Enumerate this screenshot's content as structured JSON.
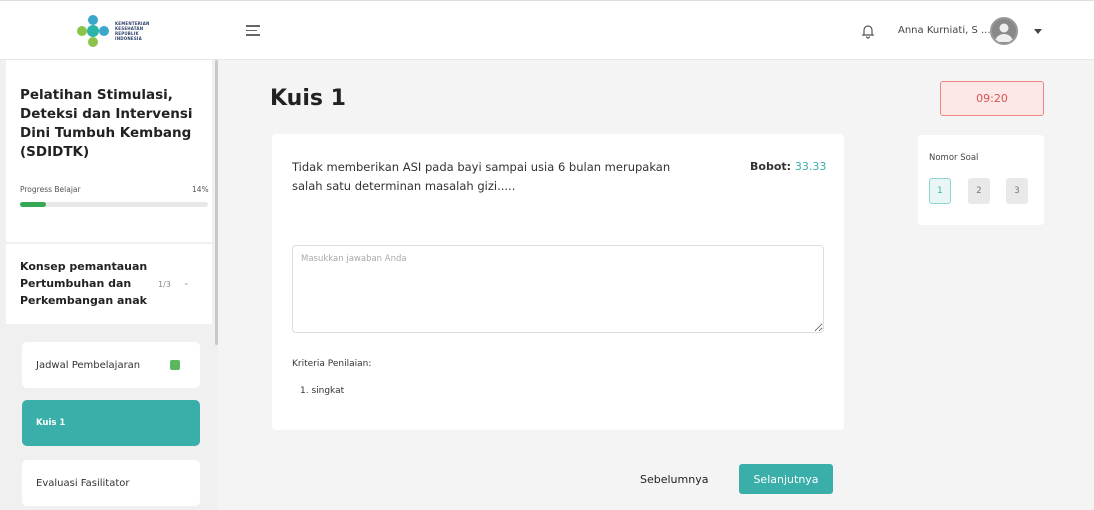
{
  "header": {
    "logo_text": [
      "KEMENTERIAN",
      "KESEHATAN",
      "REPUBLIK",
      "INDONESIA"
    ],
    "username": "Anna Kurniati, S ...",
    "icons": {
      "menu": "hamburger-icon",
      "notifications": "bell-icon",
      "dropdown": "caret-down-icon"
    }
  },
  "sidebar": {
    "course_title": "Pelatihan Stimulasi, Deteksi dan Intervensi Dini Tumbuh Kembang (SDIDTK)",
    "progress_label": "Progress Belajar",
    "progress_text": "14%",
    "progress_value": 0.14,
    "module_title": "Konsep pemantauan Pertumbuhan dan Perkembangan anak",
    "module_count": "1/3",
    "items": [
      {
        "label": "Jadwal Pembelajaran",
        "completed": true,
        "active": false
      },
      {
        "label": "Kuis 1",
        "completed": false,
        "active": true
      },
      {
        "label": "Evaluasi Fasilitator",
        "completed": false,
        "active": false
      }
    ]
  },
  "main": {
    "title": "Kuis 1",
    "question": "Tidak memberikan ASI pada bayi sampai usia 6 bulan merupakan salah satu determinan masalah gizi.....",
    "bobot_label": "Bobot:",
    "bobot_value": "33.33",
    "answer_placeholder": "Masukkan jawaban Anda",
    "criteria_label": "Kriteria Penilaian:",
    "criteria_items": [
      "1. singkat"
    ],
    "prev_button": "Sebelumnya",
    "next_button": "Selanjutnya"
  },
  "right_panel": {
    "timer": "09:20",
    "soal_label": "Nomor Soal",
    "soal_numbers": [
      "1",
      "2",
      "3"
    ],
    "active_soal": "1"
  },
  "colors": {
    "accent": "#3aafa9",
    "progress": "#34a853",
    "timer": "#d9534f"
  }
}
